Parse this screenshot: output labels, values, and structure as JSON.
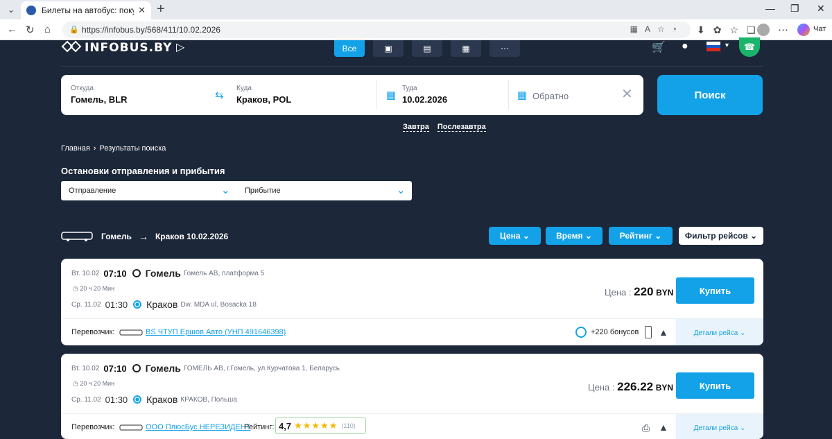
{
  "browser": {
    "tab_title": "Билеты на автобус: покупай, зак",
    "url": "https://infobus.by/568/411/10.02.2026",
    "chat_label": "Чат"
  },
  "site": {
    "logo": "INFOBUS.BY",
    "mode_all": "Все"
  },
  "search": {
    "from_label": "Откуда",
    "from_value": "Гомель, BLR",
    "to_label": "Куда",
    "to_value": "Краков, POL",
    "date_label": "Туда",
    "date_value": "10.02.2026",
    "return_placeholder": "Обратно",
    "search_button": "Поиск",
    "quick_tomorrow": "Завтра",
    "quick_after_tomorrow": "Послезавтра"
  },
  "breadcrumb": {
    "home": "Главная",
    "sep": "›",
    "current": "Результаты поиска"
  },
  "stops": {
    "title": "Остановки отправления и прибытия",
    "departure": "Отправление",
    "arrival": "Прибытие"
  },
  "route": {
    "from": "Гомель",
    "to_date": "Краков 10.02.2026"
  },
  "sort": {
    "price": "Цена",
    "time": "Время",
    "rating": "Рейтинг",
    "filter": "Фильтр рейсов"
  },
  "trips": [
    {
      "dep_day": "Вт. 10.02",
      "dep_time": "07:10",
      "dep_city": "Гомель",
      "dep_station": "Гомель АВ, платформа 5",
      "duration": "20 ч 20 Мин",
      "arr_day": "Ср. 11.02",
      "arr_time": "01:30",
      "arr_city": "Краков",
      "arr_station": "Dw. MDA ul. Bosacka 18",
      "price_label": "Цена :",
      "price": "220",
      "currency": "BYN",
      "buy": "Купить",
      "carrier_label": "Перевозчик:",
      "carrier": "ВS ЧТУП Ершов Авто (УНП 491646398)",
      "bonus": "+220 бонусов",
      "details": "Детали рейса"
    },
    {
      "dep_day": "Вт. 10.02",
      "dep_time": "07:10",
      "dep_city": "Гомель",
      "dep_station": "ГОМЕЛЬ АВ, г.Гомель, ул.Курчатова 1, Беларусь",
      "duration": "20 ч 20 Мин",
      "arr_day": "Ср. 11.02",
      "arr_time": "01:30",
      "arr_city": "Краков",
      "arr_station": "КРАКОВ, Польша",
      "price_label": "Цена :",
      "price": "226.22",
      "currency": "BYN",
      "buy": "Купить",
      "carrier_label": "Перевозчик:",
      "carrier": "ООО ПлюсБус НЕРЕЗИДЕНТ",
      "rating_label": "Рейтинг:",
      "rating": "4,7",
      "rating_stars": 4.7,
      "rating_count": "(110)",
      "details": "Детали рейса"
    }
  ],
  "colors": {
    "background": "#1c2739",
    "accent": "#13a2e8",
    "support": "#1bb46b"
  }
}
